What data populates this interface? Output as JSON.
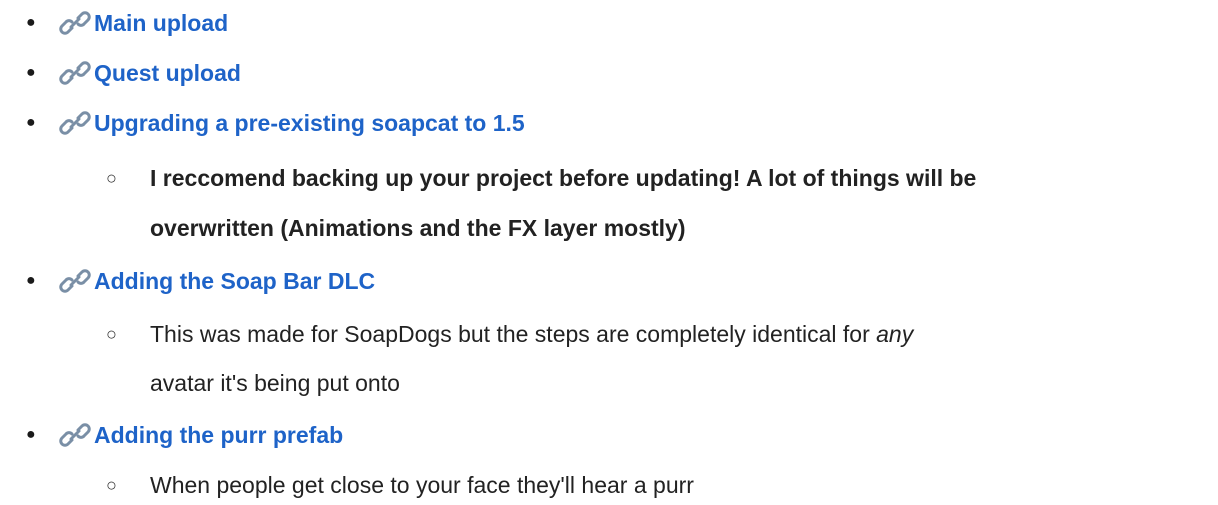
{
  "bullet_glyph": "●",
  "sub_bullet_glyph": "○",
  "link_color": "#1e63c8",
  "icon": "link-chain-icon",
  "items": [
    {
      "label": "Main upload"
    },
    {
      "label": "Quest upload"
    },
    {
      "label": "Upgrading a pre-existing soapcat to 1.5",
      "note": {
        "line1": "I reccomend backing up your project before updating! A lot of things will be",
        "line2": "overwritten (Animations and the FX layer mostly)"
      }
    },
    {
      "label": "Adding the Soap Bar DLC",
      "note": {
        "line1_before": "This was made for SoapDogs but the steps are completely identical for ",
        "line1_em": "any",
        "line2": "avatar it's being put onto"
      }
    },
    {
      "label": "Adding the purr prefab",
      "note": {
        "line1": "When people get close to your face they'll hear a purr"
      }
    }
  ]
}
